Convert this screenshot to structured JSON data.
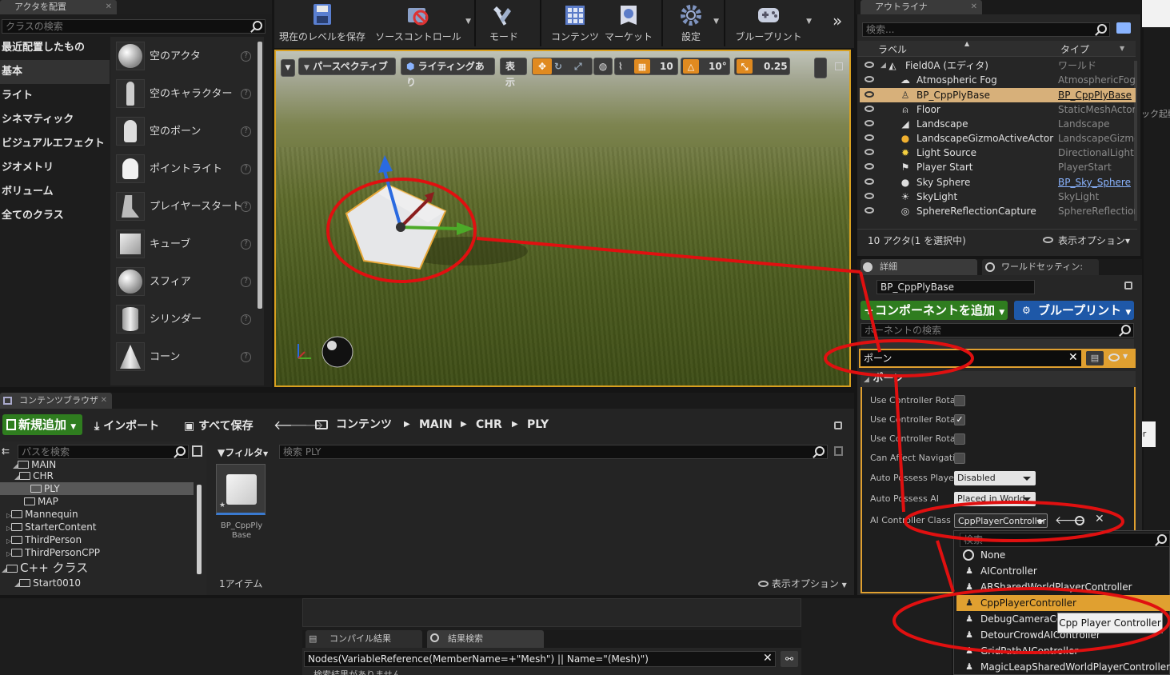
{
  "place_actors": {
    "tab": "アクタを配置",
    "search_placeholder": "クラスの検索",
    "categories": [
      "最近配置したもの",
      "基本",
      "ライト",
      "シネマティック",
      "ビジュアルエフェクト",
      "ジオメトリ",
      "ボリューム",
      "全てのクラス"
    ],
    "items": [
      "空のアクタ",
      "空のキャラクター",
      "空のポーン",
      "ポイントライト",
      "プレイヤースタート",
      "キューブ",
      "スフィア",
      "シリンダー",
      "コーン"
    ]
  },
  "toolbar": {
    "buttons": [
      "現在のレベルを保存",
      "ソースコントロール",
      "モード",
      "コンテンツ",
      "マーケット",
      "設定",
      "ブループリント"
    ],
    "more": "»"
  },
  "viewport": {
    "perspective": "パースペクティブ",
    "lighting": "ライティングあり",
    "show": "表示",
    "grid_snap": "10",
    "rot_snap": "10°",
    "scale_snap": "0.25"
  },
  "outliner": {
    "tab": "アウトライナ",
    "search_placeholder": "検索...",
    "col_label": "ラベル",
    "col_type": "タイプ",
    "rows": [
      {
        "name": "Field0A (エディタ)",
        "type": "ワールド",
        "icon": "world-icon"
      },
      {
        "name": "Atmospheric Fog",
        "type": "AtmosphericFog",
        "icon": "fog-icon"
      },
      {
        "name": "BP_CppPlyBase",
        "type": "BP_CppPlyBase",
        "icon": "pawn-icon"
      },
      {
        "name": "Floor",
        "type": "StaticMeshActor",
        "icon": "mesh-icon"
      },
      {
        "name": "Landscape",
        "type": "Landscape",
        "icon": "landscape-icon"
      },
      {
        "name": "LandscapeGizmoActiveActor",
        "type": "LandscapeGizmc",
        "icon": "gizmo-icon"
      },
      {
        "name": "Light Source",
        "type": "DirectionalLight",
        "icon": "light-icon"
      },
      {
        "name": "Player Start",
        "type": "PlayerStart",
        "icon": "flag-icon"
      },
      {
        "name": "Sky Sphere",
        "type": "BP_Sky_Sphere",
        "icon": "sphere-icon"
      },
      {
        "name": "SkyLight",
        "type": "SkyLight",
        "icon": "skylight-icon"
      },
      {
        "name": "SphereReflectionCapture",
        "type": "SphereReflection",
        "icon": "reflection-icon"
      }
    ],
    "footer_count": "10 アクタ(1 を選択中)",
    "view_options": "表示オプション▾"
  },
  "details": {
    "tab": "詳細",
    "tab2": "ワールドセッティン:",
    "name_value": "BP_CppPlyBase",
    "add_component": "コンポーネントを追加",
    "blueprint": "ブループリント",
    "component_search": "ポーネントの検索",
    "filter_value": "ポーン",
    "section": "ポーン",
    "props": [
      {
        "label": "Use Controller Rotat",
        "checked": false
      },
      {
        "label": "Use Controller Rotat",
        "checked": true
      },
      {
        "label": "Use Controller Rotat",
        "checked": false
      },
      {
        "label": "Can Affect Navigati",
        "checked": false
      }
    ],
    "auto_possess_player": {
      "label": "Auto Possess Playe",
      "value": "Disabled"
    },
    "auto_possess_ai": {
      "label": "Auto Possess AI",
      "value": "Placed in World"
    },
    "ai_controller": {
      "label": "AI Controller Class",
      "value": "CppPlayerController"
    }
  },
  "class_dropdown": {
    "search_placeholder": "検索",
    "items": [
      "None",
      "AIController",
      "ARSharedWorldPlayerController",
      "CppPlayerController",
      "DebugCameraController",
      "DetourCrowdAIController",
      "GridPathAIController",
      "MagicLeapSharedWorldPlayerController"
    ],
    "tooltip": "Cpp Player Controller"
  },
  "content_browser": {
    "tab": "コンテンツブラウザ",
    "add_new": "新規追加",
    "import": "インポート",
    "save_all": "すべて保存",
    "breadcrumbs": [
      "コンテンツ",
      "MAIN",
      "CHR",
      "PLY"
    ],
    "path_search_placeholder": "パスを検索",
    "filter": "フィルタ",
    "search_placeholder": "検索 PLY",
    "tree": [
      "MAIN",
      "CHR",
      "PLY",
      "MAP",
      "Mannequin",
      "StarterContent",
      "ThirdPerson",
      "ThirdPersonCPP",
      "C++ クラス",
      "Start0010"
    ],
    "asset_name": "BP_CppPly Base",
    "item_count": "1アイテム",
    "view_options": "表示オプション"
  },
  "bottom": {
    "compile_tab": "コンパイル結果",
    "search_tab": "結果検索",
    "search_value": "Nodes(VariableReference(MemberName=+\"Mesh\") || Name=\"(Mesh)\")",
    "result_text": "検索結果がありません"
  },
  "right_fragment": {
    "text": "ック起動",
    "er": "er"
  },
  "colors": {
    "accent_orange": "#e0a030",
    "green_button": "#2f7d1f",
    "blue_button": "#1e58a8",
    "selected_row": "#d7b07a",
    "annotation_red": "#e01010"
  }
}
